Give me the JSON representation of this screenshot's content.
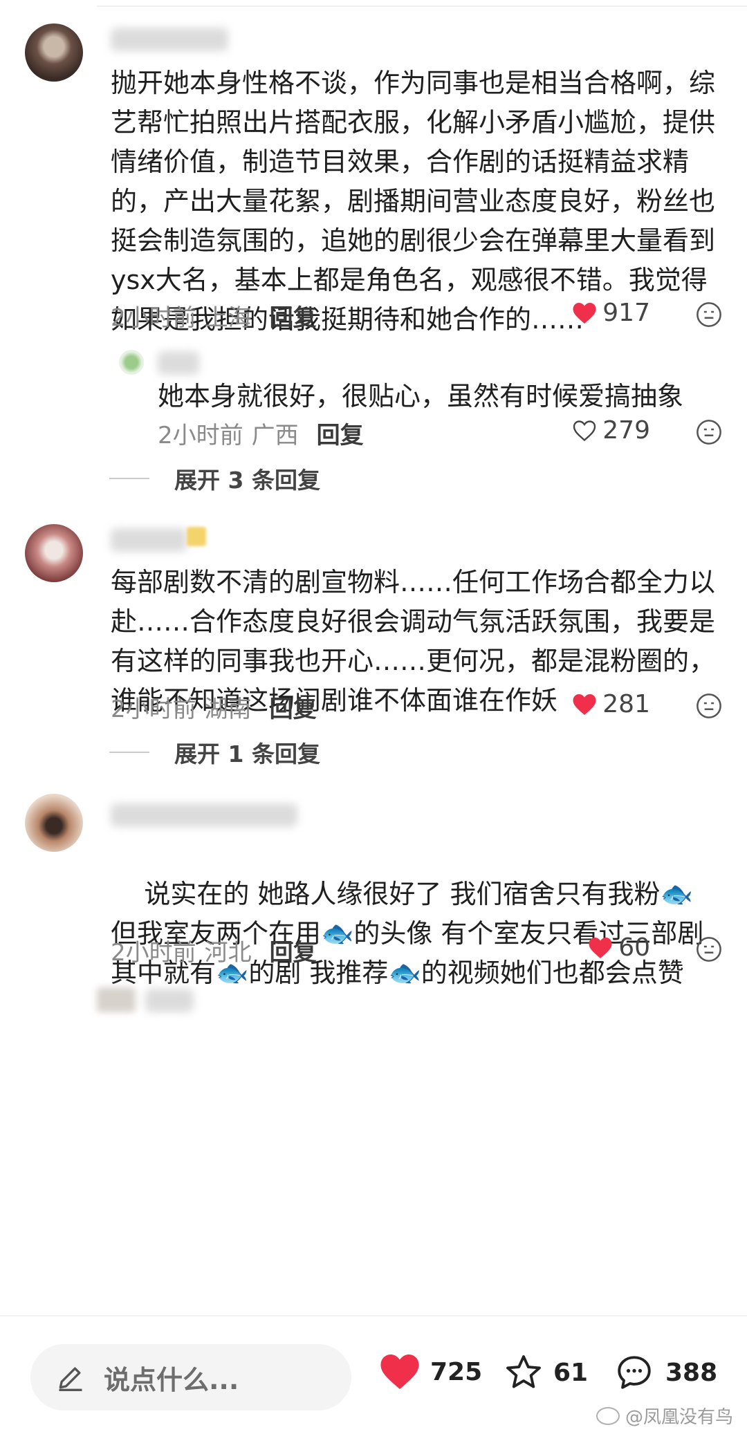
{
  "comments": [
    {
      "text": "抛开她本身性格不谈，作为同事也是相当合格啊，综艺帮忙拍照出片搭配衣服，化解小矛盾小尴尬，提供情绪价值，制造节目效果，合作剧的话挺精益求精的，产出大量花絮，剧播期间营业态度良好，粉丝也挺会制造氛围的，追她的剧很少会在弹幕里大量看到ysx大名，基本上都是角色名，观感很不错。我觉得如果是我担的话我挺期待和她合作的……",
      "time": "2小时前",
      "location": "上海",
      "reply_label": "回复",
      "likes": "917",
      "liked": true,
      "sub_reply": {
        "text": "她本身就很好，很贴心，虽然有时候爱搞抽象",
        "time": "2小时前",
        "location": "广西",
        "reply_label": "回复",
        "likes": "279",
        "liked": false
      },
      "expand_label": "展开 3 条回复"
    },
    {
      "text": "每部剧数不清的剧宣物料……任何工作场合都全力以赴……合作态度良好很会调动气氛活跃氛围，我要是有这样的同事我也开心……更何况，都是混粉圈的，谁能不知道这场闹剧谁不体面谁在作妖",
      "time": "2小时前",
      "location": "湖南",
      "reply_label": "回复",
      "likes": "281",
      "liked": true,
      "expand_label": "展开 1 条回复"
    },
    {
      "text_segments": [
        "说实在的 她路人缘很好了 我们宿舍只有我粉",
        "🐟",
        " 但我室友两个在用",
        "🐟",
        "的头像 有个室友只看过三部剧其中就有",
        "🐟",
        "的剧 我推荐",
        "🐟",
        "的视频她们也都会点赞"
      ],
      "time": "2小时前",
      "location": "河北",
      "reply_label": "回复",
      "likes": "60",
      "liked": true
    }
  ],
  "bottom_bar": {
    "input_placeholder": "说点什么...",
    "like_count": "725",
    "favorite_count": "61",
    "comment_count": "388"
  },
  "watermark": "@凤凰没有鸟",
  "colors": {
    "like_red": "#f0304a",
    "meta_gray": "#8a8a8a",
    "background": "#ffffff"
  }
}
